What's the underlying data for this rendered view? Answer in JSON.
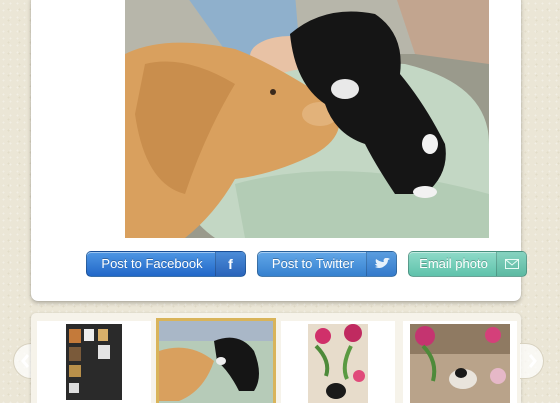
{
  "share": {
    "facebook_label": "Post to Facebook",
    "facebook_icon": "f",
    "twitter_label": "Post to Twitter",
    "email_label": "Email photo"
  },
  "photo": {
    "subject": "dog-and-kitten-photo"
  },
  "thumbnails": [
    {
      "name": "thumbnail-app-screenshot",
      "selected": false
    },
    {
      "name": "thumbnail-dog-kitten",
      "selected": true
    },
    {
      "name": "thumbnail-flowers-kitten",
      "selected": false
    },
    {
      "name": "thumbnail-flowers-room",
      "selected": false
    }
  ],
  "colors": {
    "facebook": "#2a6fcf",
    "twitter": "#3b8ad8",
    "email": "#6ccab4",
    "selected_border": "#d9b45a"
  }
}
